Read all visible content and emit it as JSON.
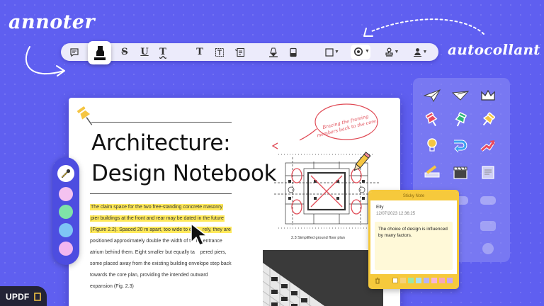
{
  "headings": {
    "annoter": "annoter",
    "autocollant": "autocollant"
  },
  "toolbar": {
    "tools": [
      {
        "name": "comment-icon"
      },
      {
        "name": "highlighter-icon",
        "active": true
      },
      {
        "name": "strikethrough-icon",
        "label": "S"
      },
      {
        "name": "underline-icon",
        "label": "U"
      },
      {
        "name": "squiggly-underline-icon",
        "label": "T"
      },
      {
        "name": "text-comment-icon",
        "label": "T"
      },
      {
        "name": "text-box-icon"
      },
      {
        "name": "callout-icon"
      },
      {
        "name": "pencil-icon"
      },
      {
        "name": "eraser-icon"
      },
      {
        "name": "shape-icon"
      },
      {
        "name": "color-ring-icon"
      },
      {
        "name": "stamp-icon"
      },
      {
        "name": "signature-icon"
      }
    ]
  },
  "document": {
    "title_line_1": "Architecture:",
    "title_line_2": "Design Notebook",
    "body_lines": [
      {
        "text": "The claim space for the two free-standing concrete masonry",
        "highlight": true
      },
      {
        "text": "pier buildings at the front and rear may be dated in the future",
        "highlight": true
      },
      {
        "text": "(Figure 2.2). Spaced 20 m apart, too wide to enti",
        "tail": "rely, they are",
        "highlight": true
      },
      {
        "text": "positioned approximately double the width of t",
        "tail": "he entrance",
        "highlight": false
      },
      {
        "text": "atrium behind them. Eight smaller but equally ta",
        "tail": "pered piers,",
        "highlight": false
      },
      {
        "text": "some placed away from the existing building envelope step back",
        "highlight": false
      },
      {
        "text": "towards the core plan, providing the intended outward",
        "highlight": false
      },
      {
        "text": "expansion (Fig. 2.3)",
        "highlight": false
      }
    ],
    "annotation_bubble": "Bracing the framing members back to the core.",
    "plan_caption": "2.3    Simplified ground floor plan"
  },
  "color_picker": {
    "colors": [
      "#f4c2f0",
      "#7fe3a8",
      "#7ec5f5",
      "#f3b6f0"
    ],
    "tool_color": "#f5d142"
  },
  "sticky_note": {
    "header": "Sticky Note",
    "user": "Elly",
    "date": "12/07/2023 12:36:25",
    "body": "The choice of design is influenced by many factors.",
    "palette": [
      "#ffffff",
      "#f6d27a",
      "#9fe8a5",
      "#a7e0f7",
      "#b9b4f5",
      "#f6b6d9",
      "#f7a8b9",
      "#c9a8f5"
    ]
  },
  "brand": {
    "logo": "UPDF"
  }
}
